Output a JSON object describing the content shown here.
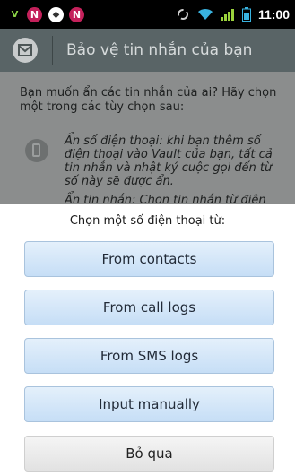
{
  "status_bar": {
    "time": "11:00",
    "notification_icons": [
      "vault-v-icon",
      "n-icon",
      "shield-icon",
      "n-icon"
    ],
    "system_icons": [
      "sync-icon",
      "wifi-icon",
      "signal-icon",
      "battery-icon"
    ]
  },
  "background": {
    "title": "Bảo vệ tin nhắn của bạn",
    "intro": "Bạn muốn ẩn các tin nhắn của ai? Hãy chọn một trong các tùy chọn sau:",
    "option_hide_number": "Ẩn số điện thoại: khi bạn thêm số điện thoại vào Vault của bạn, tất cả tin nhắn và nhật ký cuộc gọi đến từ số này sẽ được ẩn.",
    "option_hide_sms_partial": "Ẩn tin nhắn: Chọn tin nhắn từ điện"
  },
  "chooser": {
    "title": "Chọn một số điện thoại từ:",
    "options": [
      "From contacts",
      "From call logs",
      "From SMS logs",
      "Input manually"
    ],
    "cancel": "Bỏ qua"
  },
  "colors": {
    "status_bar": "#000000",
    "title_bar": "#596466",
    "dim_overlay": "#8b8d8d",
    "button_top": "#e4f0fb",
    "button_bottom": "#c6def6",
    "n_badge": "#c4215b"
  }
}
